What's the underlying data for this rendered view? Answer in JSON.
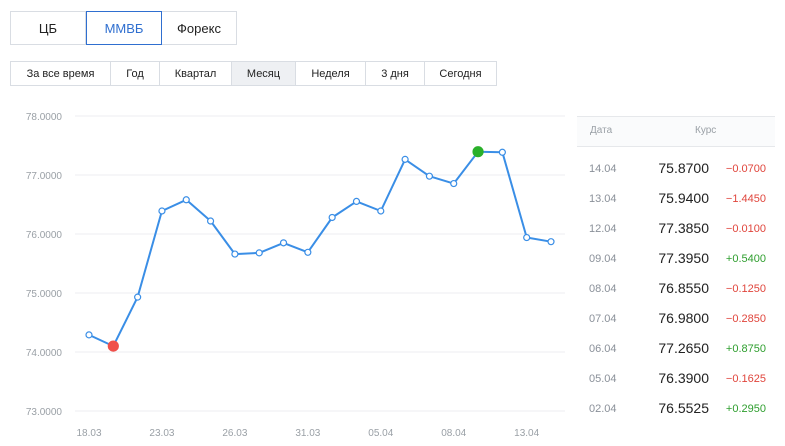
{
  "source_tabs": [
    {
      "label": "ЦБ",
      "active": false
    },
    {
      "label": "ММВБ",
      "active": true
    },
    {
      "label": "Форекс",
      "active": false
    }
  ],
  "period_tabs": [
    {
      "label": "За все время",
      "active": false
    },
    {
      "label": "Год",
      "active": false
    },
    {
      "label": "Квартал",
      "active": false
    },
    {
      "label": "Месяц",
      "active": true
    },
    {
      "label": "Неделя",
      "active": false
    },
    {
      "label": "3 дня",
      "active": false
    },
    {
      "label": "Сегодня",
      "active": false
    }
  ],
  "chart_data": {
    "type": "line",
    "x_tick_labels": [
      "18.03",
      "23.03",
      "26.03",
      "31.03",
      "05.04",
      "08.04",
      "13.04"
    ],
    "x_tick_indices": [
      0,
      3,
      6,
      9,
      12,
      15,
      18
    ],
    "y_tick_labels": [
      "78.0000",
      "77.0000",
      "76.0000",
      "75.0000",
      "74.0000",
      "73.0000"
    ],
    "ylim": [
      73,
      78
    ],
    "grid": true,
    "series": [
      {
        "color": "#3a8ee6",
        "values": [
          74.29,
          74.1,
          74.93,
          76.39,
          76.58,
          76.22,
          75.66,
          75.68,
          75.85,
          75.69,
          76.28,
          76.5525,
          76.39,
          77.265,
          76.98,
          76.855,
          77.395,
          77.385,
          75.94,
          75.87
        ]
      }
    ],
    "highlights": {
      "min": {
        "index": 1,
        "color": "#f0504a"
      },
      "max": {
        "index": 16,
        "color": "#2ab02a"
      }
    }
  },
  "table": {
    "head_date": "Дата",
    "head_rate": "Курс",
    "rows": [
      {
        "date": "14.04",
        "rate": "75.8700",
        "delta": "−0.0700",
        "dir": "down"
      },
      {
        "date": "13.04",
        "rate": "75.9400",
        "delta": "−1.4450",
        "dir": "down"
      },
      {
        "date": "12.04",
        "rate": "77.3850",
        "delta": "−0.0100",
        "dir": "down"
      },
      {
        "date": "09.04",
        "rate": "77.3950",
        "delta": "+0.5400",
        "dir": "up"
      },
      {
        "date": "08.04",
        "rate": "76.8550",
        "delta": "−0.1250",
        "dir": "down"
      },
      {
        "date": "07.04",
        "rate": "76.9800",
        "delta": "−0.2850",
        "dir": "down"
      },
      {
        "date": "06.04",
        "rate": "77.2650",
        "delta": "+0.8750",
        "dir": "up"
      },
      {
        "date": "05.04",
        "rate": "76.3900",
        "delta": "−0.1625",
        "dir": "down"
      },
      {
        "date": "02.04",
        "rate": "76.5525",
        "delta": "+0.2950",
        "dir": "up"
      }
    ]
  }
}
